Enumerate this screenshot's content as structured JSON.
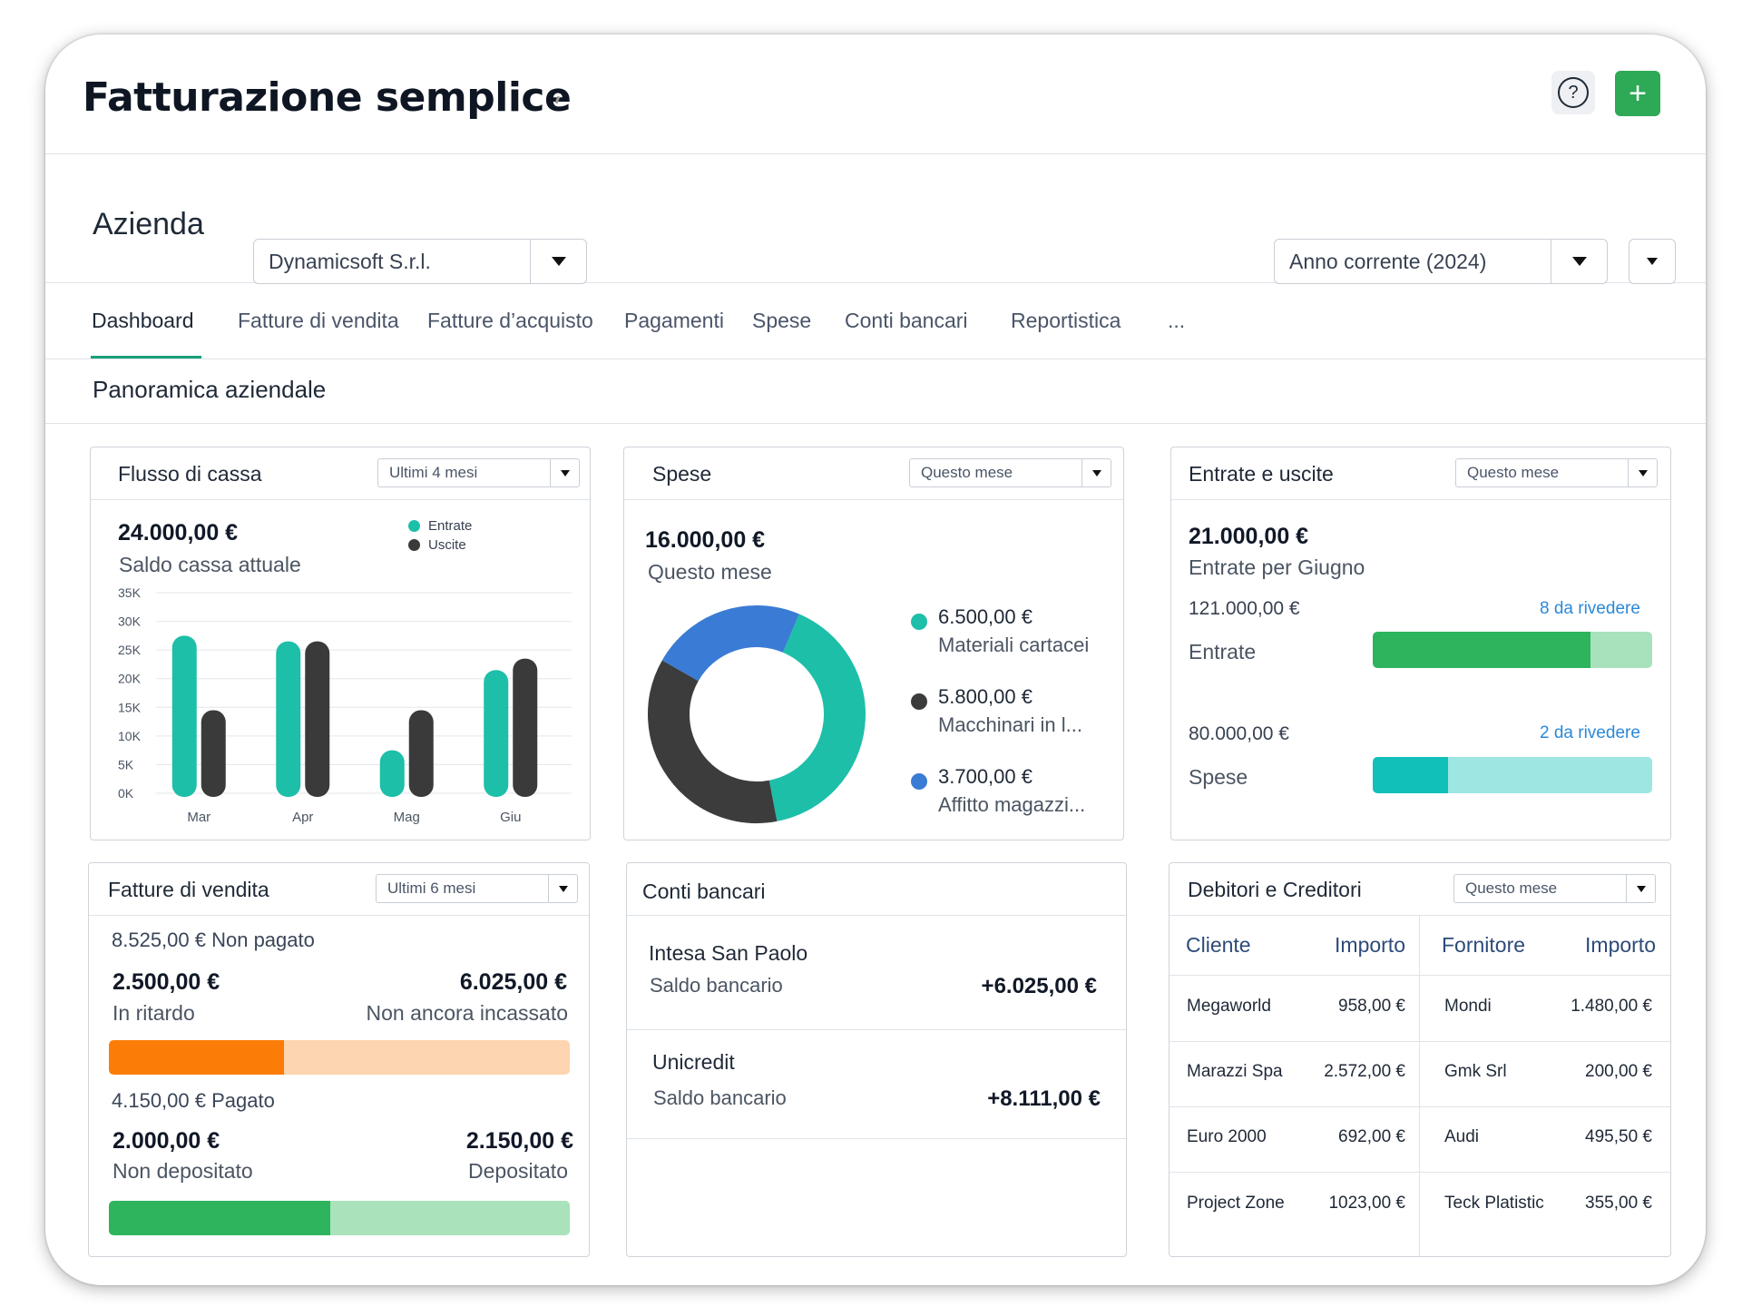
{
  "app": {
    "title": "Fatturazione semplice"
  },
  "header": {
    "help_icon": "question-circle-icon",
    "add_label": "+"
  },
  "company": {
    "label": "Azienda",
    "selected": "Dynamicsoft S.r.l.",
    "period": "Anno corrente (2024)"
  },
  "tabs": [
    {
      "label": "Dashboard"
    },
    {
      "label": "Fatture di vendita"
    },
    {
      "label": "Fatture d’acquisto"
    },
    {
      "label": "Pagamenti"
    },
    {
      "label": "Spese"
    },
    {
      "label": "Conti bancari"
    },
    {
      "label": "Reportistica"
    },
    {
      "label": "..."
    }
  ],
  "section": {
    "title": "Panoramica aziendale"
  },
  "cashflow": {
    "title": "Flusso di cassa",
    "filter": "Ultimi 4 mesi",
    "amount": "24.000,00 €",
    "amount_label": "Saldo cassa attuale",
    "legend": {
      "in": "Entrate",
      "out": "Uscite"
    }
  },
  "chart_data": {
    "type": "bar",
    "categories": [
      "Mar",
      "Apr",
      "Mag",
      "Giu"
    ],
    "series": [
      {
        "name": "Entrate",
        "values": [
          27500,
          26500,
          7500,
          21500
        ],
        "color": "#1dbfa9"
      },
      {
        "name": "Uscite",
        "values": [
          14500,
          26500,
          14500,
          23500
        ],
        "color": "#3a3a3a"
      }
    ],
    "ylim": [
      0,
      35000
    ],
    "yticks": [
      "0K",
      "5K",
      "10K",
      "15K",
      "20K",
      "25K",
      "30K",
      "35K"
    ],
    "grid": true,
    "legend": "top-right"
  },
  "expenses": {
    "title": "Spese",
    "filter": "Questo mese",
    "amount": "16.000,00 €",
    "amount_label": "Questo mese",
    "items": [
      {
        "amount": "6.500,00 €",
        "label": "Materiali cartacei",
        "value": 6500,
        "color": "#1dbfa9"
      },
      {
        "amount": "5.800,00 €",
        "label": "Macchinari in l...",
        "value": 5800,
        "color": "#3c3c3c"
      },
      {
        "amount": "3.700,00 €",
        "label": "Affitto magazzi...",
        "value": 3700,
        "color": "#3a7bd5"
      }
    ]
  },
  "inout": {
    "title": "Entrate e uscite",
    "filter": "Questo mese",
    "amount": "21.000,00 €",
    "amount_label": "Entrate per Giugno",
    "rows": [
      {
        "amount": "121.000,00 €",
        "review": "8 da rivedere",
        "label": "Entrate",
        "fraction": 0.78,
        "fill": "#2db45c",
        "track": "#a8e2bd"
      },
      {
        "amount": "80.000,00 €",
        "review": "2 da rivedere",
        "label": "Spese",
        "fraction": 0.27,
        "fill": "#10c0b9",
        "track": "#9de6e2"
      }
    ]
  },
  "sales": {
    "title": "Fatture di vendita",
    "filter": "Ultimi 6 mesi",
    "unpaid": "8.525,00 € Non pagato",
    "late_amount": "2.500,00 €",
    "late_label": "In ritardo",
    "pending_amount": "6.025,00 €",
    "pending_label": "Non ancora incassato",
    "unpaid_fraction": 0.38,
    "paid": "4.150,00 € Pagato",
    "notdep_amount": "2.000,00 €",
    "notdep_label": "Non depositato",
    "dep_amount": "2.150,00 €",
    "dep_label": "Depositato",
    "paid_fraction": 0.48
  },
  "banks": {
    "title": "Conti bancari",
    "accounts": [
      {
        "name": "Intesa San Paolo",
        "label": "Saldo bancario",
        "balance": "+6.025,00 €"
      },
      {
        "name": "Unicredit",
        "label": "Saldo bancario",
        "balance": "+8.111,00 €"
      }
    ]
  },
  "debts": {
    "title": "Debitori e Creditori",
    "filter": "Questo mese",
    "headers": [
      "Cliente",
      "Importo",
      "Fornitore",
      "Importo"
    ],
    "rows": [
      [
        "Megaworld",
        "958,00 €",
        "Mondi",
        "1.480,00 €"
      ],
      [
        "Marazzi Spa",
        "2.572,00 €",
        "Gmk Srl",
        "200,00 €"
      ],
      [
        "Euro 2000",
        "692,00 €",
        "Audi",
        "495,50 €"
      ],
      [
        "Project Zone",
        "1023,00 €",
        "Teck Platistic",
        "355,00 €"
      ]
    ]
  }
}
